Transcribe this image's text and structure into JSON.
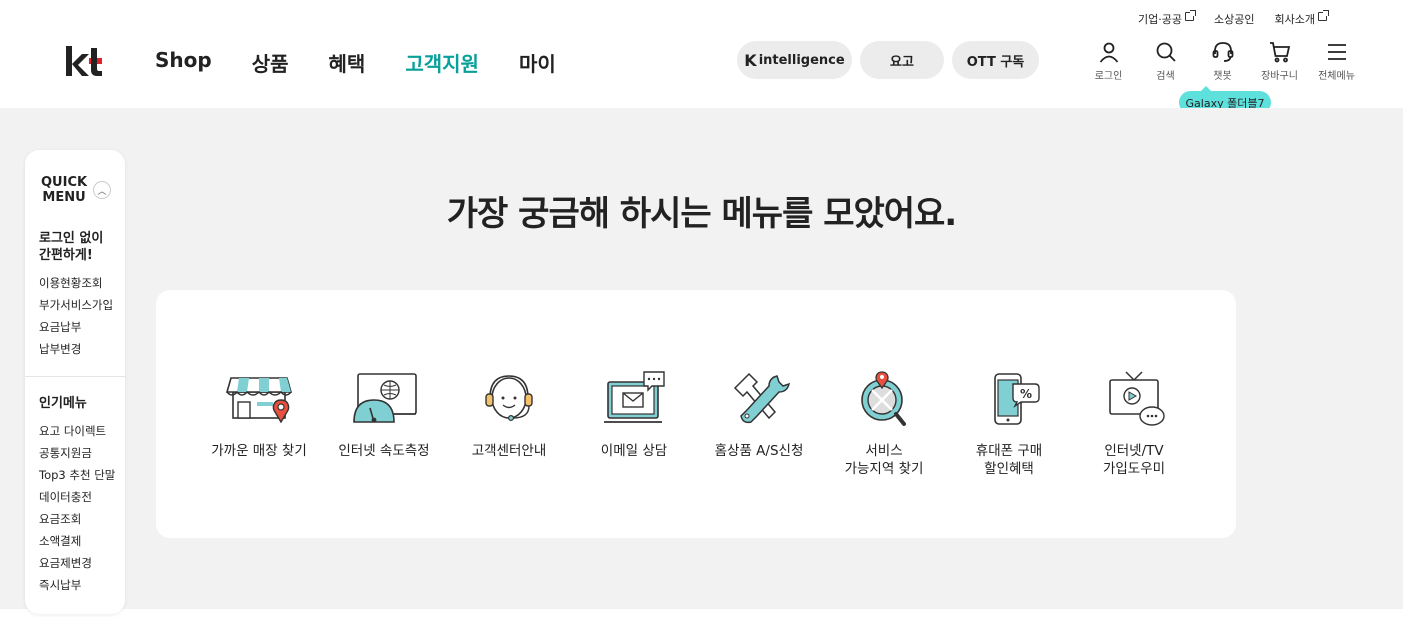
{
  "utility": {
    "corporate": "기업·공공",
    "small_business": "소상공인",
    "company": "회사소개"
  },
  "gnb": [
    "Shop",
    "상품",
    "혜택",
    "고객지원",
    "마이"
  ],
  "gnb_active": "고객지원",
  "pills": {
    "intelligence": "intelligence",
    "intelligence_mark": "K",
    "yogo": "요고",
    "ott": "OTT 구독"
  },
  "header_icons": [
    {
      "label": "로그인",
      "icon": "user-icon"
    },
    {
      "label": "검색",
      "icon": "search-icon"
    },
    {
      "label": "챗봇",
      "icon": "chatbot-icon"
    },
    {
      "label": "장바구니",
      "icon": "cart-icon"
    },
    {
      "label": "전체메뉴",
      "icon": "menu-icon"
    }
  ],
  "badge": "Galaxy 폴더블7",
  "quick_menu": {
    "title_line1": "QUICK",
    "title_line2": "MENU",
    "section1_title_line1": "로그인 없이",
    "section1_title_line2": "간편하게!",
    "section1_links": [
      "이용현황조회",
      "부가서비스가입",
      "요금납부",
      "납부변경"
    ],
    "section2_title": "인기메뉴",
    "section2_links": [
      "요고 다이렉트",
      "공통지원금",
      "Top3 추천 단말",
      "데이터충전",
      "요금조회",
      "소액결제",
      "요금제변경",
      "즉시납부"
    ]
  },
  "headline": "가장 궁금해 하시는 메뉴를 모았어요.",
  "menu_items": [
    {
      "label": "가까운 매장 찾기",
      "icon": "store-location-icon"
    },
    {
      "label": "인터넷 속도측정",
      "icon": "speed-test-icon"
    },
    {
      "label": "고객센터안내",
      "icon": "headset-icon"
    },
    {
      "label": "이메일 상담",
      "icon": "email-icon"
    },
    {
      "label": "홈상품 A/S신청",
      "icon": "tools-icon"
    },
    {
      "label": "서비스\n가능지역 찾기",
      "icon": "area-search-icon"
    },
    {
      "label": "휴대폰 구매\n할인혜택",
      "icon": "phone-discount-icon"
    },
    {
      "label": "인터넷/TV\n가입도우미",
      "icon": "tv-help-icon"
    }
  ],
  "colors": {
    "accent": "#0aa09a",
    "logo_red": "#e4202a",
    "badge": "#5ee0dc",
    "background": "#f2f2f2"
  }
}
